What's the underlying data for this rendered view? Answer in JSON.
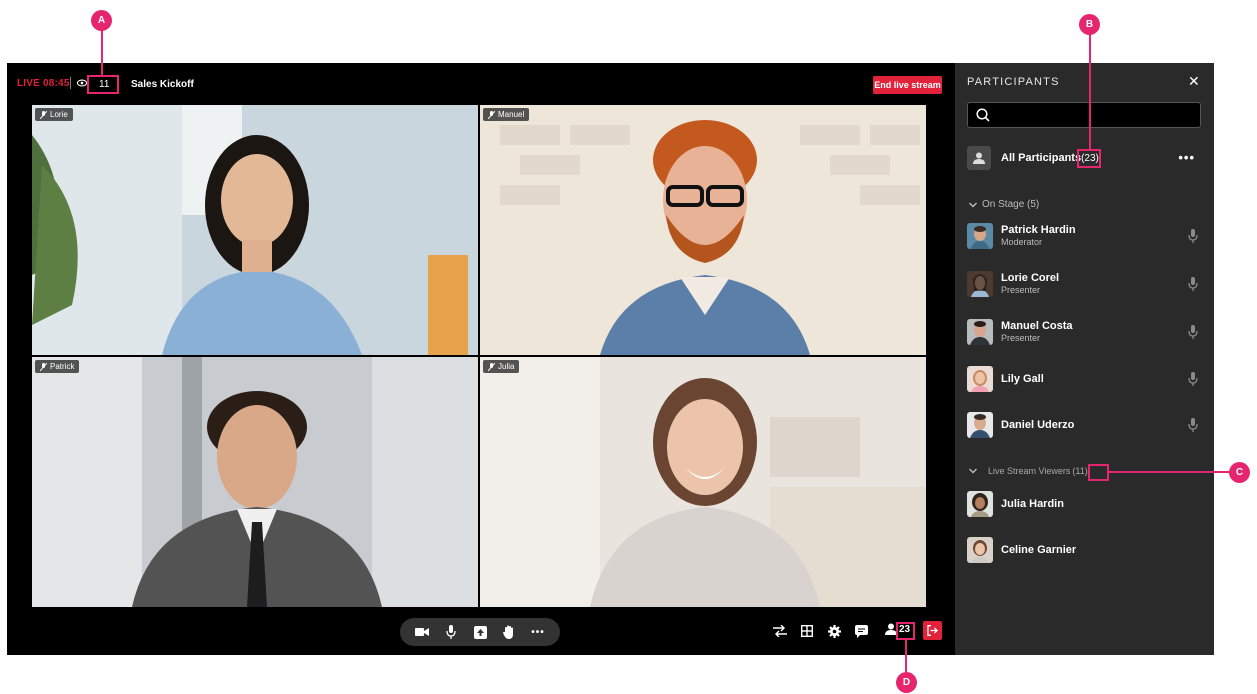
{
  "topbar": {
    "live_label": "LIVE 08:45",
    "viewer_count": "11",
    "meeting_title": "Sales Kickoff",
    "end_button": "End live stream"
  },
  "tiles": [
    {
      "name": "Lorie"
    },
    {
      "name": "Manuel"
    },
    {
      "name": "Patrick"
    },
    {
      "name": "Julia"
    }
  ],
  "controls": {
    "pill_icons": [
      "video-camera-icon",
      "microphone-icon",
      "share-screen-icon",
      "raise-hand-icon",
      "more-icon"
    ],
    "right_icons": [
      "switch-icon",
      "grid-layout-icon",
      "settings-icon",
      "chat-icon"
    ],
    "participant_count": "23"
  },
  "panel": {
    "title": "PARTICIPANTS",
    "close": "✕",
    "all_participants_label": "All Participants",
    "all_participants_count": "(23)",
    "more": "•••",
    "on_stage_label": "On Stage (5)",
    "on_stage": [
      {
        "name": "Patrick Hardin",
        "role": "Moderator"
      },
      {
        "name": "Lorie Corel",
        "role": "Presenter"
      },
      {
        "name": "Manuel Costa",
        "role": "Presenter"
      },
      {
        "name": "Lily Gall",
        "role": ""
      },
      {
        "name": "Daniel Uderzo",
        "role": ""
      }
    ],
    "viewers_label": "Live Stream Viewers",
    "viewers_count": "(11)",
    "viewers": [
      {
        "name": "Julia Hardin"
      },
      {
        "name": "Celine Garnier"
      }
    ]
  },
  "annotations": {
    "a": "A",
    "b": "B",
    "c": "C",
    "d": "D"
  },
  "colors": {
    "accent_red": "#e2213b",
    "annotation_pink": "#e5256e",
    "panel_bg": "#2a2a2a"
  }
}
